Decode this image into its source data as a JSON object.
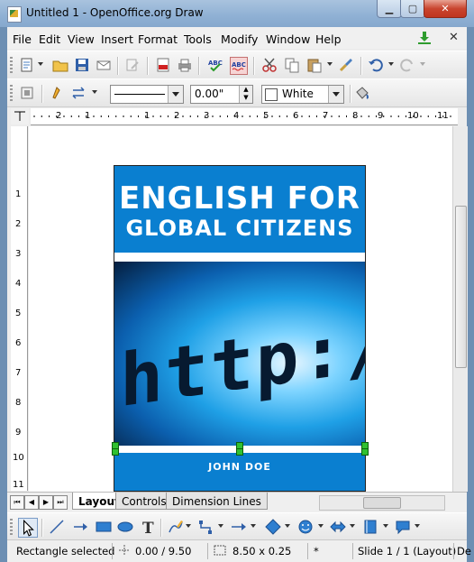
{
  "window": {
    "title": "Untitled 1 - OpenOffice.org Draw",
    "minimize_label": "▁",
    "maximize_label": "▢",
    "close_label": "✕"
  },
  "menu": {
    "items": [
      "File",
      "Edit",
      "View",
      "Insert",
      "Format",
      "Tools",
      "Modify",
      "Window",
      "Help"
    ],
    "close_doc": "✕"
  },
  "line_toolbar": {
    "line_width": "0.00\"",
    "area_color": "White"
  },
  "rulers": {
    "horizontal_ticks": [
      "2",
      "1",
      "1",
      "2",
      "3",
      "4",
      "5",
      "6",
      "7",
      "8",
      "9",
      "10",
      "11"
    ],
    "vertical_ticks": [
      "1",
      "2",
      "3",
      "4",
      "5",
      "6",
      "7",
      "8",
      "9",
      "10",
      "11"
    ]
  },
  "document": {
    "cover_title_line1": "ENGLISH FOR",
    "cover_title_line2": "GLOBAL CITIZENS",
    "image_text": "http://w",
    "author": "JOHN DOE",
    "colors": {
      "cover_blue": "#0a7fd0",
      "handle_green": "#30c030"
    }
  },
  "tabs": {
    "nav_buttons": [
      "⏮",
      "◀",
      "▶",
      "⏭"
    ],
    "items": [
      "Layout",
      "Controls",
      "Dimension Lines"
    ],
    "active": "Layout"
  },
  "status": {
    "selection": "Rectangle selected",
    "position": "0.00 / 9.50",
    "size": "8.50 x 0.25",
    "modified": "*",
    "slide": "Slide 1 / 1 (Layout)",
    "trailing": "De"
  }
}
